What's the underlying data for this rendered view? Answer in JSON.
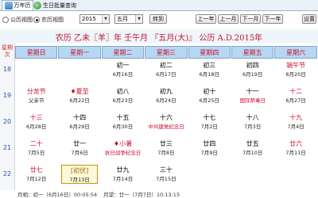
{
  "tabs": [
    "万年历",
    "生日批量查询"
  ],
  "toolbar": {
    "radio_gregorian": "公历视图",
    "radio_lunar": "农历视图",
    "year_value": "2015",
    "month_value": "五月",
    "goto_label": "转到",
    "prev_year": "上一年",
    "prev_month": "上一月",
    "next_month": "下一月",
    "next_year": "下一年",
    "settings_label": "设置"
  },
  "header": {
    "title": "农历 乙未〖羊〗年 壬午月 『五月(大)』 公历 A.D.2015年"
  },
  "week_label": "星期\n次",
  "weekday_headers": [
    "星期日",
    "星期一",
    "星期二",
    "星期三",
    "星期四",
    "星期五",
    "星期六"
  ],
  "weeks": [
    {
      "num": "18",
      "days": [
        {
          "top": "",
          "bot": ""
        },
        {
          "top": "",
          "bot": ""
        },
        {
          "top": "初一",
          "bot": "6月16日"
        },
        {
          "top": "初二",
          "bot": "6月17日"
        },
        {
          "top": "初三",
          "bot": "6月18日"
        },
        {
          "top": "初四",
          "bot": "6月19日"
        },
        {
          "top": "端午节",
          "bot": "6月20日",
          "red": true
        }
      ]
    },
    {
      "num": "19",
      "days": [
        {
          "top": "分龙节",
          "bot": "父亲节",
          "red": true
        },
        {
          "top": "♦夏至",
          "bot": "6月22日",
          "red": true
        },
        {
          "top": "初八",
          "bot": "6月23日"
        },
        {
          "top": "初九",
          "bot": "6月24日"
        },
        {
          "top": "初十",
          "bot": "6月25日"
        },
        {
          "top": "十一",
          "bot": "国际禁毒日",
          "botred": true
        },
        {
          "top": "十二",
          "bot": "6月27日",
          "red": true
        }
      ]
    },
    {
      "num": "20",
      "days": [
        {
          "top": "十三",
          "bot": "6月28日",
          "red": true
        },
        {
          "top": "十四",
          "bot": "6月29日"
        },
        {
          "top": "十五",
          "bot": "6月30日"
        },
        {
          "top": "十六",
          "bot": "中共建党纪念日",
          "botred": true
        },
        {
          "top": "十七",
          "bot": "7月2日"
        },
        {
          "top": "十八",
          "bot": "7月3日"
        },
        {
          "top": "十九",
          "bot": "7月4日",
          "red": true
        }
      ]
    },
    {
      "num": "21",
      "days": [
        {
          "top": "二十",
          "bot": "7月5日",
          "red": true
        },
        {
          "top": "廿一",
          "bot": "7月6日"
        },
        {
          "top": "♦小暑",
          "bot": "抗日战争纪念日",
          "red": true,
          "botred": true
        },
        {
          "top": "廿三",
          "bot": "7月8日"
        },
        {
          "top": "廿四",
          "bot": "7月9日"
        },
        {
          "top": "廿五",
          "bot": "7月10日"
        },
        {
          "top": "廿六",
          "bot": "7月11日",
          "red": true
        }
      ]
    },
    {
      "num": "22",
      "days": [
        {
          "top": "廿七",
          "bot": "7月12日",
          "red": true
        },
        {
          "top": "[初伏]",
          "bot": "7月13日",
          "today": true
        },
        {
          "top": "廿九",
          "bot": "7月14日"
        },
        {
          "top": "三十",
          "bot": "7月15日"
        },
        {
          "top": "",
          "bot": ""
        },
        {
          "top": "",
          "bot": ""
        },
        {
          "top": "",
          "bot": ""
        }
      ]
    }
  ],
  "status_bar": [
    "月相：初一（6月16日）00:05:54",
    "月望：廿一（7月7日）10:13:15"
  ]
}
